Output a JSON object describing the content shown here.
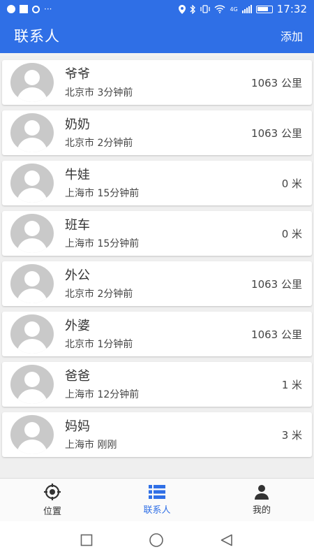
{
  "status_bar": {
    "time": "17:32",
    "network": "4G",
    "left_icons": [
      "notification-icon",
      "sim-icon",
      "app-icon",
      "more-dots-icon"
    ],
    "right_icons": [
      "location-icon",
      "bluetooth-icon",
      "vibrate-icon",
      "wifi-icon",
      "signal-icon",
      "battery-icon"
    ]
  },
  "app_bar": {
    "title": "联系人",
    "action_label": "添加",
    "color": "#2f6fe6"
  },
  "contacts": [
    {
      "name": "爷爷",
      "subtitle": "北京市 3分钟前",
      "distance": "1063 公里"
    },
    {
      "name": "奶奶",
      "subtitle": "北京市 2分钟前",
      "distance": "1063 公里"
    },
    {
      "name": "牛娃",
      "subtitle": "上海市 15分钟前",
      "distance": "0 米"
    },
    {
      "name": "班车",
      "subtitle": "上海市 15分钟前",
      "distance": "0 米"
    },
    {
      "name": "外公",
      "subtitle": "北京市 2分钟前",
      "distance": "1063 公里"
    },
    {
      "name": "外婆",
      "subtitle": "北京市 1分钟前",
      "distance": "1063 公里"
    },
    {
      "name": "爸爸",
      "subtitle": "上海市 12分钟前",
      "distance": "1 米"
    },
    {
      "name": "妈妈",
      "subtitle": "上海市 刚刚",
      "distance": "3 米"
    }
  ],
  "bottom_nav": {
    "active": "联系人",
    "items": [
      {
        "label": "位置",
        "icon": "location-target-icon"
      },
      {
        "label": "联系人",
        "icon": "list-icon"
      },
      {
        "label": "我的",
        "icon": "person-icon"
      }
    ],
    "active_color": "#2f6fe6"
  },
  "system_nav": {
    "buttons": [
      "recent-apps-icon",
      "home-icon",
      "back-icon"
    ]
  }
}
